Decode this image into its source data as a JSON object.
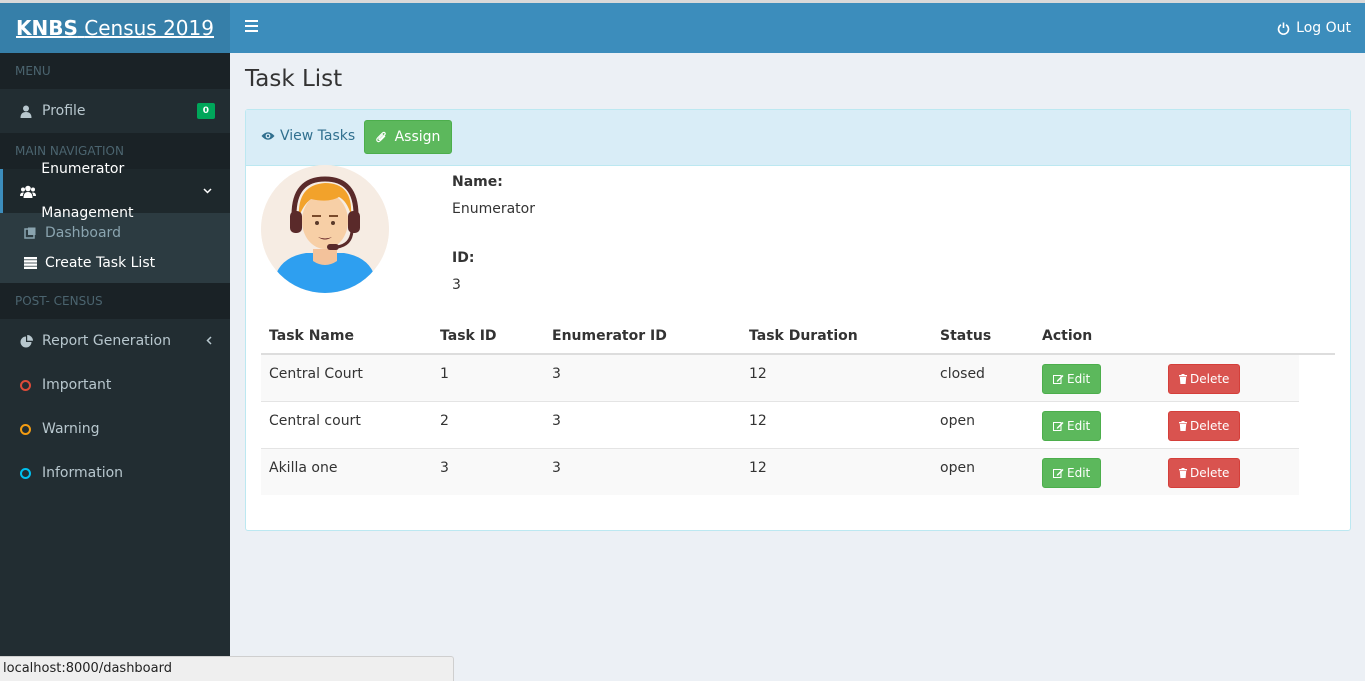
{
  "sidebar": {
    "logo_bold": "KNBS",
    "logo_rest": "Census 2019",
    "section_menu": "MENU",
    "profile": {
      "label": "Profile",
      "badge": "0"
    },
    "section_main": "MAIN NAVIGATION",
    "enumerator_management": "Enumerator Management",
    "submenu": [
      {
        "label": "Dashboard"
      },
      {
        "label": "Create Task List"
      }
    ],
    "section_post": "POST- CENSUS",
    "report_generation": "Report Generation",
    "labels": [
      {
        "label": "Important",
        "color": "#dd4b39"
      },
      {
        "label": "Warning",
        "color": "#f39c12"
      },
      {
        "label": "Information",
        "color": "#00c0ef"
      }
    ]
  },
  "header": {
    "logout": "Log Out"
  },
  "page": {
    "title": "Task List"
  },
  "toolbar": {
    "view_tasks": "View Tasks",
    "assign": "Assign"
  },
  "profile_card": {
    "name_label": "Name:",
    "name_value": "Enumerator",
    "id_label": "ID:",
    "id_value": "3"
  },
  "table": {
    "headers": [
      "Task Name",
      "Task ID",
      "Enumerator ID",
      "Task Duration",
      "Status",
      "Action"
    ],
    "rows": [
      {
        "task_name": "Central Court",
        "task_id": "1",
        "enumerator_id": "3",
        "duration": "12",
        "status": "closed"
      },
      {
        "task_name": "Central court",
        "task_id": "2",
        "enumerator_id": "3",
        "duration": "12",
        "status": "open"
      },
      {
        "task_name": "Akilla one",
        "task_id": "3",
        "enumerator_id": "3",
        "duration": "12",
        "status": "open"
      }
    ],
    "edit_label": "Edit",
    "delete_label": "Delete"
  },
  "statusbar": {
    "url": "localhost:8000/dashboard"
  },
  "colors": {
    "header": "#3c8dbc",
    "logo_bg": "#367fa9",
    "sidebar": "#222d32",
    "success": "#5cb85c",
    "danger": "#d9534f"
  }
}
